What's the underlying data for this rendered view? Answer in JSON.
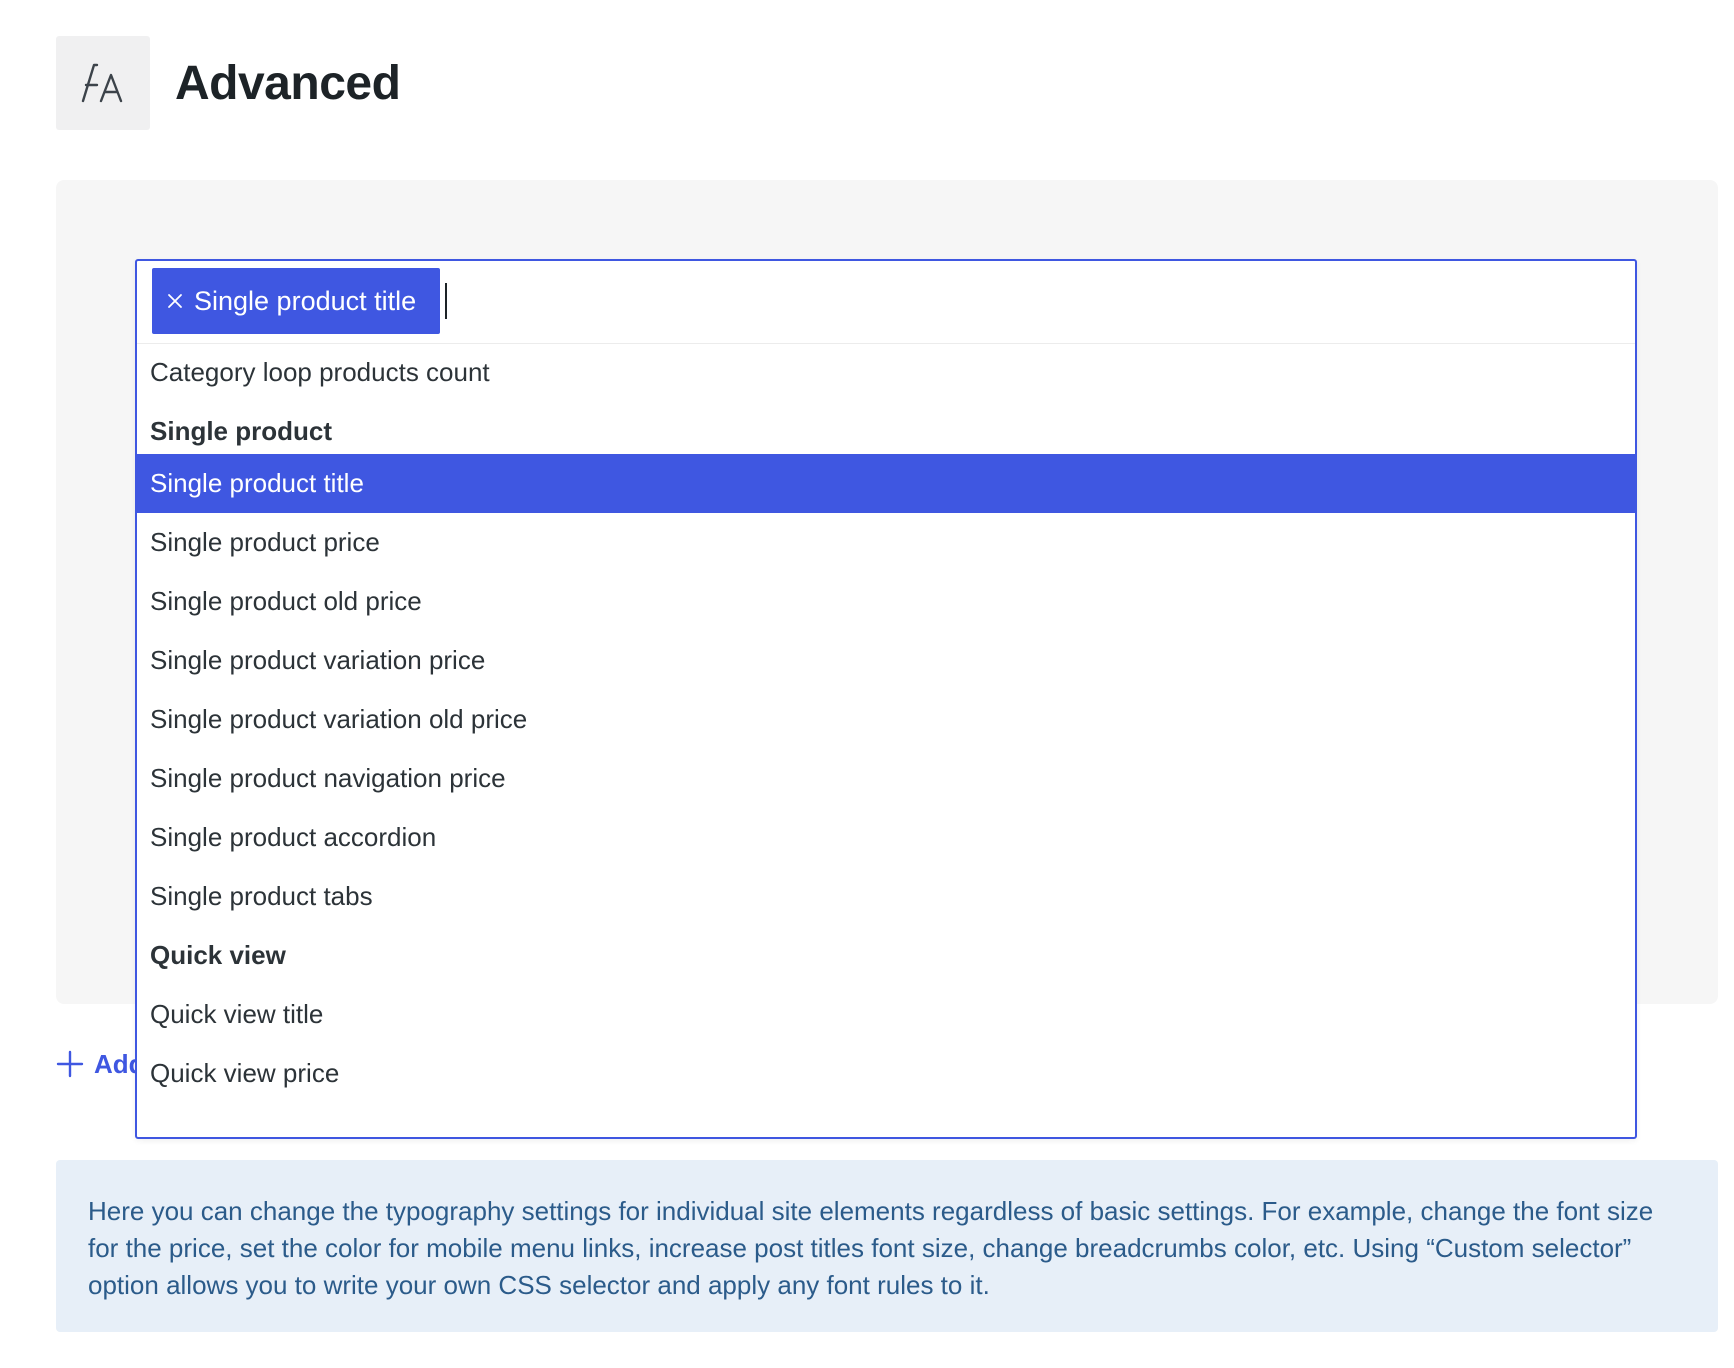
{
  "header": {
    "icon": "font-typography-icon",
    "title": "Advanced"
  },
  "select": {
    "selected_chip": "Single product title",
    "search_value": "",
    "options": [
      {
        "label": "Category loop products count",
        "type": "option"
      },
      {
        "label": "Single product",
        "type": "group"
      },
      {
        "label": "Single product title",
        "type": "option",
        "selected": true
      },
      {
        "label": "Single product price",
        "type": "option"
      },
      {
        "label": "Single product old price",
        "type": "option"
      },
      {
        "label": "Single product variation price",
        "type": "option"
      },
      {
        "label": "Single product variation old price",
        "type": "option"
      },
      {
        "label": "Single product navigation price",
        "type": "option"
      },
      {
        "label": "Single product accordion",
        "type": "option"
      },
      {
        "label": "Single product tabs",
        "type": "option"
      },
      {
        "label": "Quick view",
        "type": "group"
      },
      {
        "label": "Quick view title",
        "type": "option"
      },
      {
        "label": "Quick view price",
        "type": "option"
      }
    ]
  },
  "add_link": {
    "label_visible": "Add"
  },
  "notice": {
    "text": "Here you can change the typography settings for individual site elements regardless of basic settings. For example, change the font size for the price, set the color for mobile menu links, increase post titles font size, change breadcrumbs color, etc. Using “Custom selector” option allows you to write your own CSS selector and apply any font rules to it."
  },
  "colors": {
    "accent": "#3f57e1",
    "notice_bg": "#e7eff8",
    "notice_text": "#2b5b8a",
    "panel_bg": "#f6f6f6"
  }
}
